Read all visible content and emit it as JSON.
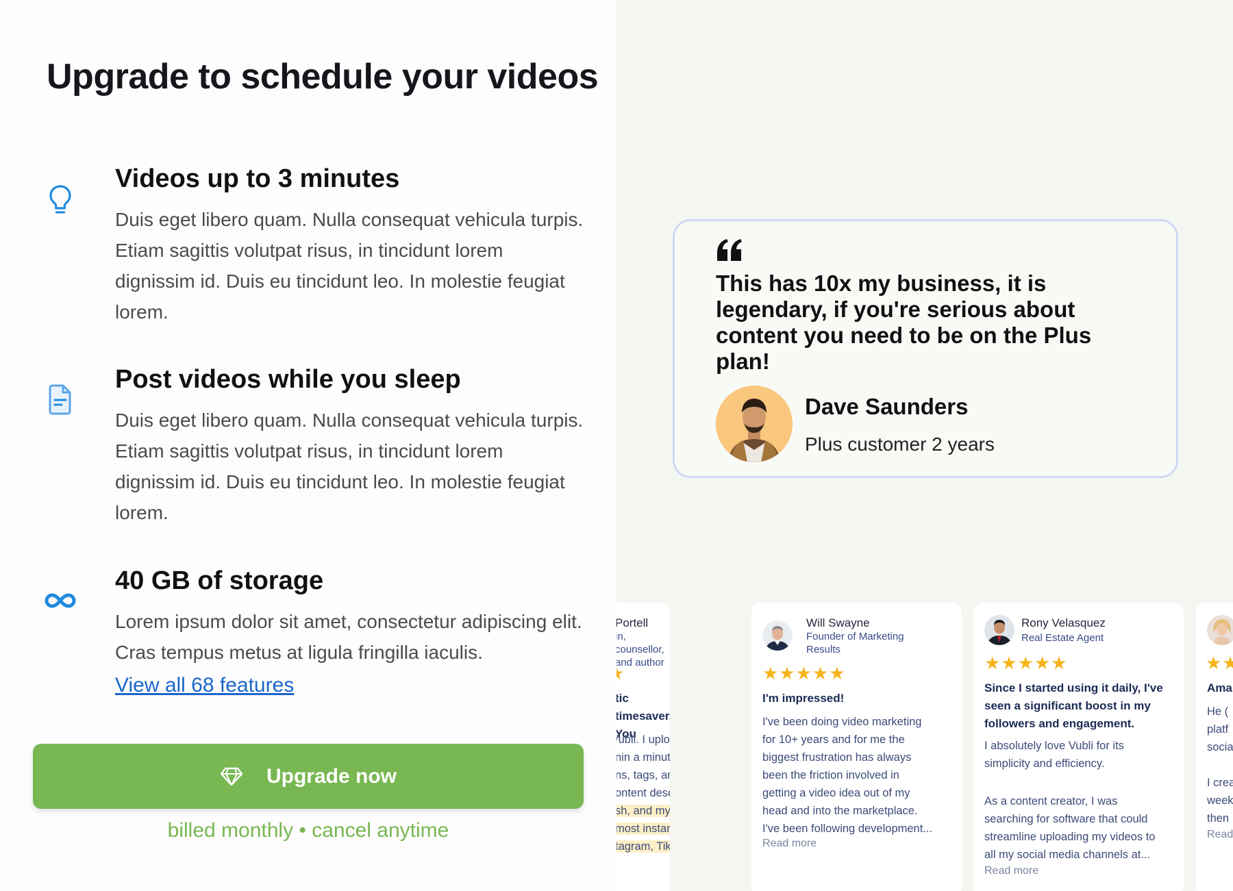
{
  "title": "Upgrade to schedule your videos",
  "features": [
    {
      "icon": "lightbulb-icon",
      "heading": "Videos up to 3 minutes",
      "body": "Duis eget libero quam. Nulla consequat vehicula turpis. Etiam sagittis volutpat risus, in tincidunt lorem dignissim id. Duis eu tincidunt leo. In molestie feugiat lorem."
    },
    {
      "icon": "document-icon",
      "heading": "Post videos while you sleep",
      "body": "Duis eget libero quam. Nulla consequat vehicula turpis. Etiam sagittis volutpat risus, in tincidunt lorem dignissim id. Duis eu tincidunt leo. In molestie feugiat lorem."
    },
    {
      "icon": "infinity-icon",
      "heading": "40 GB of storage",
      "body": "Lorem ipsum dolor sit amet, consectetur adipiscing elit. Cras tempus metus at ligula fringilla iaculis."
    }
  ],
  "view_features_link": "View all 68 features",
  "upgrade_button": {
    "label": "Upgrade now",
    "icon": "diamond-icon"
  },
  "billing_note": "billed monthly • cancel anytime",
  "colors": {
    "accent_green": "#78b752",
    "link_blue": "#1a66c9",
    "feature_icon_blue": "#1f8be0",
    "star_yellow": "#f6b41c"
  },
  "testimonial": {
    "quote": "This has 10x my business, it is legendary, if you're serious about content you need to be on the Plus plan!",
    "name": "Dave Saunders",
    "role": "Plus customer 2 years"
  },
  "reviews": [
    {
      "name": "Portell",
      "role_lines": [
        "in, counsellor,",
        "and author"
      ],
      "stars": "★",
      "title": "tic timesaver. You",
      "body_lines": [
        "/ubli. I uploaded my",
        "nin a minute, I had",
        "ns, tags, and",
        "ontent descriptions.",
        "sh, and my video",
        "most instantly to",
        "tagram, TikTok, X,..."
      ],
      "highlight_from": 4
    },
    {
      "name": "Will Swayne",
      "role_lines": [
        "Founder of Marketing",
        "Results"
      ],
      "stars": "★★★★★",
      "title": "I'm impressed!",
      "body_lines": [
        "I've been doing video marketing",
        "for 10+ years and for me the",
        "biggest frustration has always",
        "been the friction involved in",
        "getting a video idea out of my",
        "head and into the marketplace.",
        "I've been following development..."
      ],
      "more": "Read more"
    },
    {
      "name": "Rony Velasquez",
      "role": "Real Estate Agent",
      "stars": "★★★★★",
      "title_lines": [
        "Since I started using it daily, I've",
        "seen a significant boost in my",
        "followers and engagement."
      ],
      "body_lines": [
        "I absolutely love Vubli for its",
        "simplicity and efficiency."
      ],
      "body2_lines": [
        "As a content creator, I was",
        "searching for software that could",
        "streamline uploading my videos to",
        "all my social media channels at..."
      ],
      "more": "Read more"
    },
    {
      "stars": "★★",
      "title": "Ama",
      "body_lines": [
        "He (",
        "platf",
        "socia"
      ],
      "body2_lines": [
        "I crea",
        "week",
        "then"
      ],
      "more": "Read"
    }
  ]
}
